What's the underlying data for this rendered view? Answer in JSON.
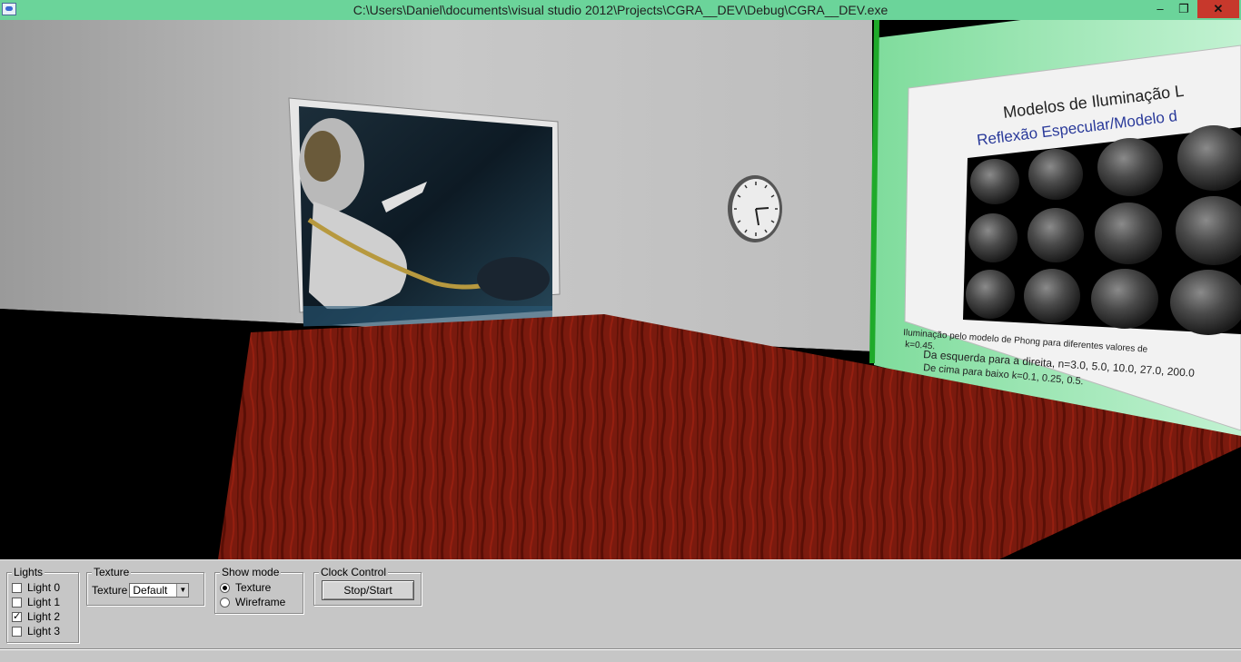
{
  "window": {
    "title": "C:\\Users\\Daniel\\documents\\visual studio 2012\\Projects\\CGRA__DEV\\Debug\\CGRA__DEV.exe",
    "minimize_glyph": "–",
    "maximize_glyph": "❐",
    "close_glyph": "✕"
  },
  "scene": {
    "poster": {
      "title": "Modelos de Iluminação L",
      "subtitle": "Reflexão Especular/Modelo d",
      "caption_line1": "Iluminação pelo modelo de Phong para diferentes valores de",
      "caption_ks": "k",
      "caption_ks_value": "=0.45.",
      "caption_line2": "Da esquerda para a direita, n=3.0, 5.0, 10.0, 27.0, 200.0",
      "caption_line3_pre": "De cima para baixo k",
      "caption_line3_post": "=0.1, 0.25, 0.5."
    }
  },
  "panel": {
    "lights": {
      "label": "Lights",
      "items": [
        {
          "label": "Light 0",
          "checked": false
        },
        {
          "label": "Light 1",
          "checked": false
        },
        {
          "label": "Light 2",
          "checked": true
        },
        {
          "label": "Light 3",
          "checked": false
        }
      ]
    },
    "texture": {
      "label": "Texture",
      "field_label": "Texture",
      "value": "Default"
    },
    "show_mode": {
      "label": "Show mode",
      "options": [
        {
          "label": "Texture",
          "selected": true
        },
        {
          "label": "Wireframe",
          "selected": false
        }
      ]
    },
    "clock_control": {
      "label": "Clock Control",
      "button_label": "Stop/Start"
    }
  },
  "colors": {
    "titlebar": "#6bd49a",
    "close_button": "#c7382c",
    "panel_bg": "#c6c6c6",
    "table_wood": "#7a1a0e",
    "green_wall": "#9be8b6"
  },
  "icons": [
    "app-icon",
    "minimize-icon",
    "maximize-icon",
    "close-icon",
    "checkmark-icon",
    "dropdown-arrow-icon"
  ]
}
